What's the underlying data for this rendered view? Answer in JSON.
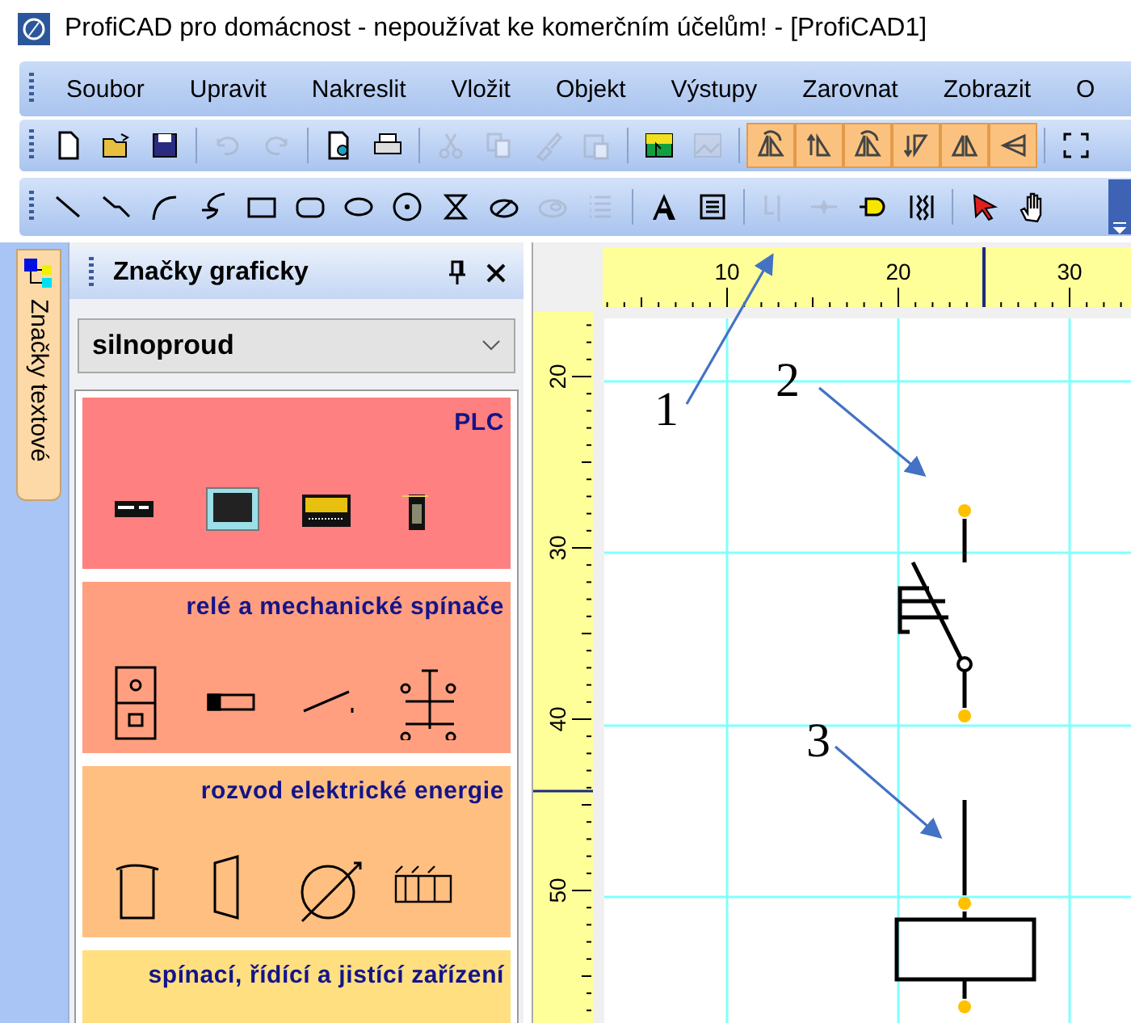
{
  "window": {
    "title": "ProfiCAD pro domácnost - nepoužívat ke komerčním účelům! - [ProfiCAD1]"
  },
  "menu": [
    "Soubor",
    "Upravit",
    "Nakreslit",
    "Vložit",
    "Objekt",
    "Výstupy",
    "Zarovnat",
    "Zobrazit",
    "O"
  ],
  "toolbar_1": [
    {
      "disabled": false,
      "highlighted": false
    },
    {
      "disabled": false,
      "highlighted": false
    },
    {
      "disabled": false,
      "highlighted": false
    },
    {
      "disabled": true,
      "highlighted": false
    },
    {
      "disabled": true,
      "highlighted": false
    },
    {
      "disabled": false,
      "highlighted": false
    },
    {
      "disabled": false,
      "highlighted": false
    },
    {
      "disabled": true,
      "highlighted": false
    },
    {
      "disabled": true,
      "highlighted": false
    },
    {
      "disabled": true,
      "highlighted": false
    },
    {
      "disabled": true,
      "highlighted": false
    },
    {
      "disabled": false,
      "highlighted": false
    },
    {
      "disabled": true,
      "highlighted": false
    },
    {
      "disabled": false,
      "highlighted": true
    },
    {
      "disabled": false,
      "highlighted": true
    },
    {
      "disabled": false,
      "highlighted": true
    },
    {
      "disabled": false,
      "highlighted": true
    },
    {
      "disabled": false,
      "highlighted": true
    },
    {
      "disabled": false,
      "highlighted": true
    },
    {
      "disabled": false,
      "highlighted": false
    }
  ],
  "toolbar_2": [
    {
      "disabled": false
    },
    {
      "disabled": false
    },
    {
      "disabled": false
    },
    {
      "disabled": false
    },
    {
      "disabled": false
    },
    {
      "disabled": false
    },
    {
      "disabled": false
    },
    {
      "disabled": false
    },
    {
      "disabled": false
    },
    {
      "disabled": false
    },
    {
      "disabled": true
    },
    {
      "disabled": true
    },
    {
      "disabled": false
    },
    {
      "disabled": false
    },
    {
      "disabled": true
    },
    {
      "disabled": true
    },
    {
      "disabled": false
    },
    {
      "disabled": false
    },
    {
      "disabled": false
    },
    {
      "disabled": false
    }
  ],
  "side_tabs": [
    {
      "label": "Značky textové"
    }
  ],
  "panel": {
    "title": "Značky graficky",
    "library": "silnoproud",
    "categories": [
      {
        "name": "PLC",
        "color": "#ff8080"
      },
      {
        "name": "relé a mechanické spínače",
        "color": "#ff9f80"
      },
      {
        "name": "rozvod elektrické energie",
        "color": "#ffbf80"
      },
      {
        "name": "spínací, řídící a jistící zařízení",
        "color": "#ffdf80"
      }
    ]
  },
  "canvas": {
    "top_ruler": [
      "10",
      "20",
      "30"
    ],
    "left_ruler": [
      "20",
      "30",
      "40",
      "50"
    ]
  },
  "annotations": [
    "1",
    "2",
    "3"
  ]
}
